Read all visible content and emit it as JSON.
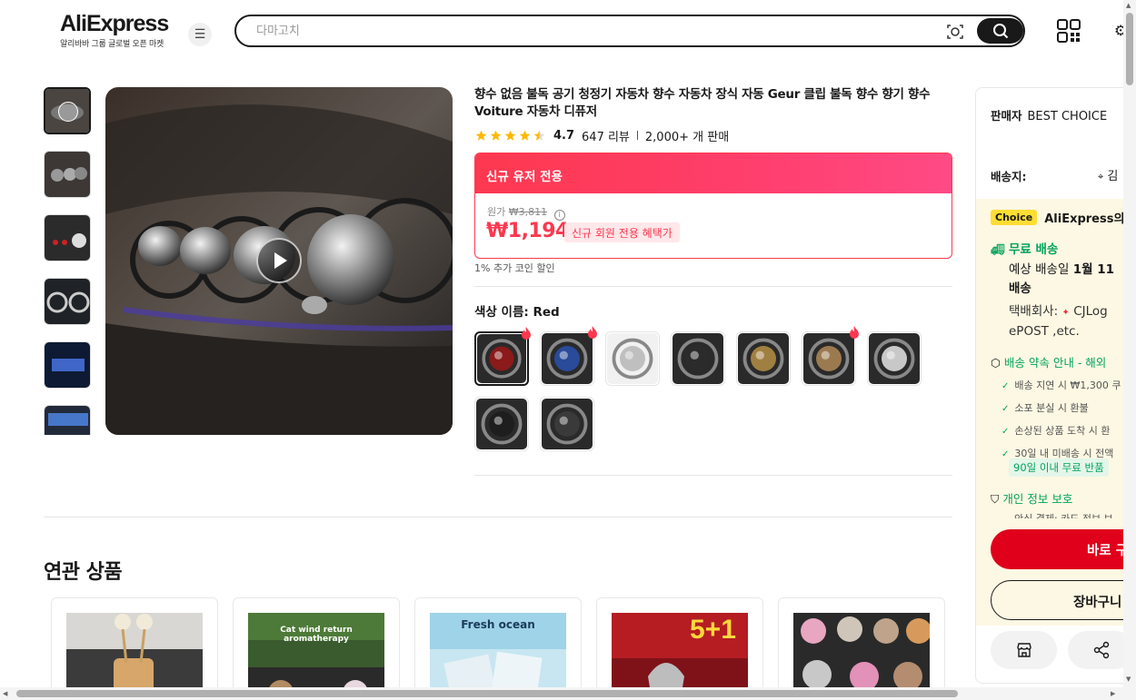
{
  "header": {
    "logo": "AliExpress",
    "logo_sub": "알리바바 그룹 글로벌 오픈 마켓",
    "search_placeholder": "다마고치"
  },
  "product": {
    "title": "향수 없음 불독 공기 청정기 자동차 향수 자동차 장식 자동 Geur 클립 불독 향수 향기 향수 Voiture 자동차 디퓨저",
    "rating": "4.7",
    "reviews": "647 리뷰",
    "sold": "2,000+ 개 판매",
    "stars": 4.5
  },
  "price": {
    "banner": "신규 유저 전용",
    "original_label": "원가",
    "original_price": "₩3,811",
    "current_price": "₩1,194",
    "promo": "신규 회원 전용 혜택가",
    "coin_note": "1% 추가 코인 할인"
  },
  "variant": {
    "label": "색상 이름: Red",
    "options": [
      {
        "color": "#8b1a1a",
        "hot": true
      },
      {
        "color": "#2a4a9a",
        "hot": true
      },
      {
        "color": "#bfbfbf",
        "hot": false
      },
      {
        "color": "#2b2b2b",
        "hot": false
      },
      {
        "color": "#a08040",
        "hot": false
      },
      {
        "color": "#9c7a50",
        "hot": true
      },
      {
        "color": "#c8c8c8",
        "hot": false
      },
      {
        "color": "#1e1e1e",
        "hot": false
      },
      {
        "color": "#3a3a3a",
        "hot": false
      }
    ]
  },
  "related": {
    "title": "연관 상품",
    "items": [
      {
        "caption": ""
      },
      {
        "caption": "Cat wind return aromatherapy"
      },
      {
        "caption": "Fresh ocean"
      },
      {
        "caption": "5+1"
      },
      {
        "caption": ""
      }
    ]
  },
  "panel": {
    "seller_label": "판매자",
    "seller_name": "BEST CHOICE",
    "ship_label": "배송지:",
    "ship_location": "김",
    "choice_badge": "Choice",
    "choice_text": "AliExpress의 우",
    "free_shipping": "무료 배송",
    "eta_prefix": "예상 배송일",
    "eta_date": "1월 11",
    "eta_suffix": "배송",
    "courier_label": "택배회사:",
    "courier_name": "CJLog",
    "courier_more": "ePOST ,etc.",
    "promise": "배송 약속 안내 - 해외",
    "promise_items": [
      "배송 지연 시 ₩1,300 쿠",
      "소포 분실 시 환불",
      "손상된 상품 도착 시 환",
      "30일 내 미배송 시 전액"
    ],
    "return_tag": "90일 이내 무료 반품",
    "privacy": "개인 정보 보호",
    "privacy_sub": "안심 결제: 카드 정보 보",
    "buy_label": "바로 구",
    "cart_label": "장바구니"
  }
}
